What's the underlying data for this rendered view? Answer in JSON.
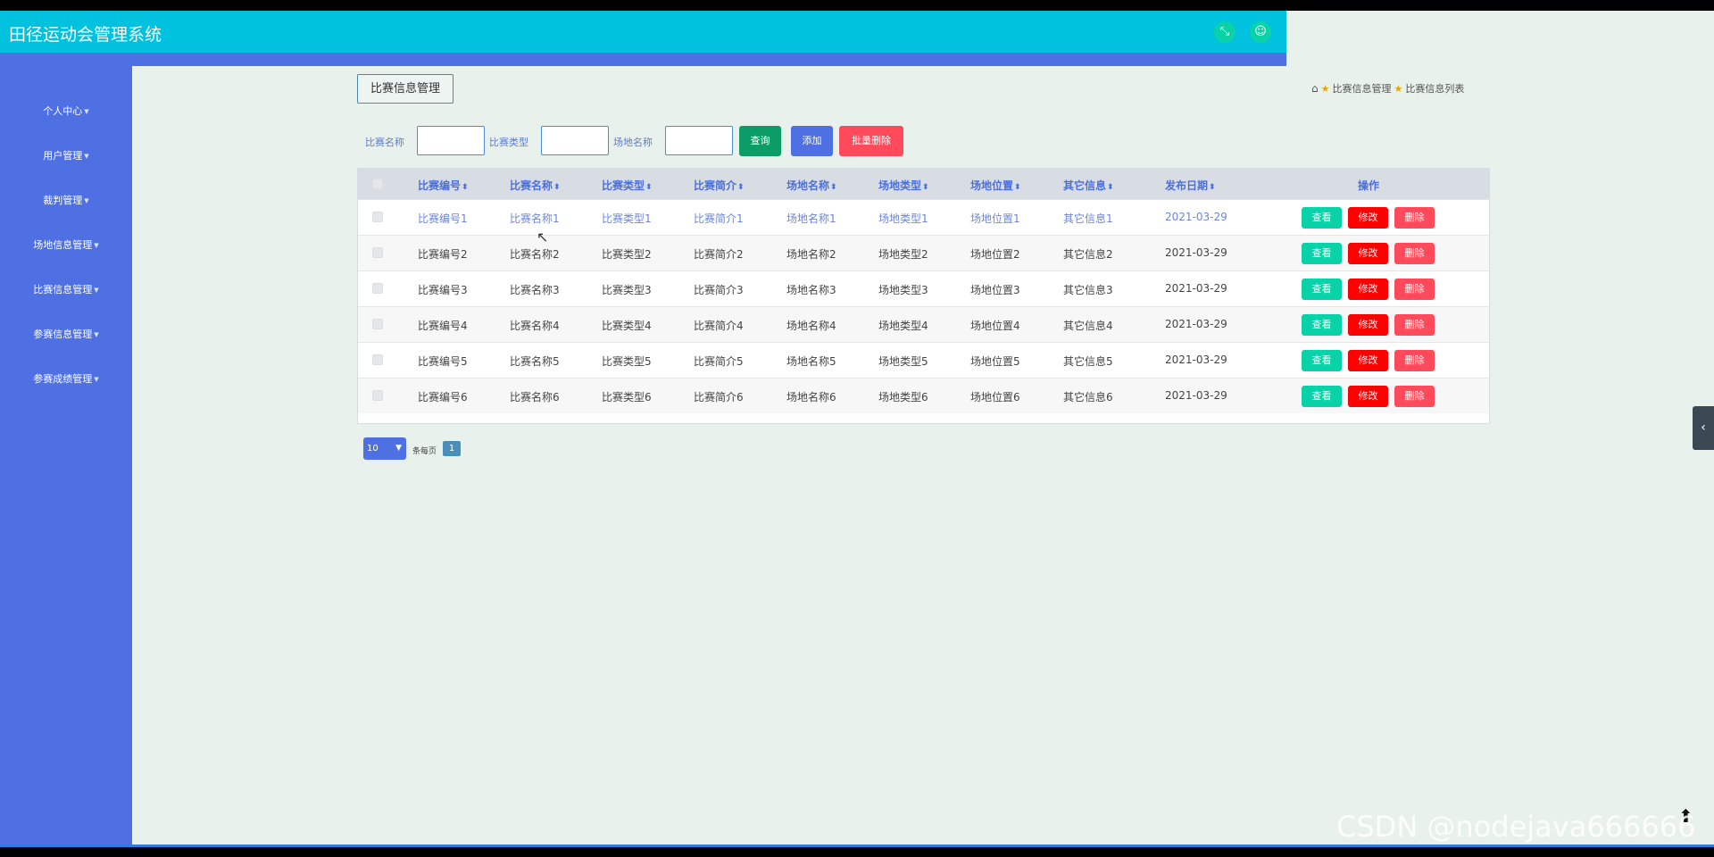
{
  "app": {
    "title": "田径运动会管理系统"
  },
  "header": {
    "fullscreen_icon": "expand-icon",
    "user_icon": "user-icon"
  },
  "sidebar": {
    "items": [
      {
        "label": "个人中心"
      },
      {
        "label": "用户管理"
      },
      {
        "label": "裁判管理"
      },
      {
        "label": "场地信息管理"
      },
      {
        "label": "比赛信息管理"
      },
      {
        "label": "参赛信息管理"
      },
      {
        "label": "参赛成绩管理"
      }
    ]
  },
  "module_button": "比赛信息管理",
  "breadcrumb": {
    "items": [
      "比赛信息管理",
      "比赛信息列表"
    ]
  },
  "filters": {
    "labels": [
      "比赛名称",
      "比赛类型",
      "场地名称"
    ],
    "values": [
      "",
      "",
      ""
    ]
  },
  "actions": {
    "search": "查询",
    "add": "添加",
    "batch_delete": "批量删除"
  },
  "table": {
    "columns": [
      "比赛编号",
      "比赛名称",
      "比赛类型",
      "比赛简介",
      "场地名称",
      "场地类型",
      "场地位置",
      "其它信息",
      "发布日期",
      "操作"
    ],
    "sort_icon": "⬍",
    "rows": [
      [
        "比赛编号1",
        "比赛名称1",
        "比赛类型1",
        "比赛简介1",
        "场地名称1",
        "场地类型1",
        "场地位置1",
        "其它信息1",
        "2021-03-29"
      ],
      [
        "比赛编号2",
        "比赛名称2",
        "比赛类型2",
        "比赛简介2",
        "场地名称2",
        "场地类型2",
        "场地位置2",
        "其它信息2",
        "2021-03-29"
      ],
      [
        "比赛编号3",
        "比赛名称3",
        "比赛类型3",
        "比赛简介3",
        "场地名称3",
        "场地类型3",
        "场地位置3",
        "其它信息3",
        "2021-03-29"
      ],
      [
        "比赛编号4",
        "比赛名称4",
        "比赛类型4",
        "比赛简介4",
        "场地名称4",
        "场地类型4",
        "场地位置4",
        "其它信息4",
        "2021-03-29"
      ],
      [
        "比赛编号5",
        "比赛名称5",
        "比赛类型5",
        "比赛简介5",
        "场地名称5",
        "场地类型5",
        "场地位置5",
        "其它信息5",
        "2021-03-29"
      ],
      [
        "比赛编号6",
        "比赛名称6",
        "比赛类型6",
        "比赛简介6",
        "场地名称6",
        "场地类型6",
        "场地位置6",
        "其它信息6",
        "2021-03-29"
      ]
    ],
    "row_actions": {
      "view": "查看",
      "edit": "修改",
      "delete": "删除"
    }
  },
  "pagination": {
    "page_size": "10",
    "per_page_label": "条每页",
    "current_page": "1"
  },
  "watermark": "CSDN @nodejava666666",
  "colors": {
    "header": "#00c1de",
    "sidebar": "#4e70e3",
    "background": "#e9f1ec",
    "search_button": "#0c9d67",
    "add_button": "#4e70e3",
    "batch_delete_button": "#ff4a5b",
    "view_button": "#0ad2a8",
    "edit_button": "#ff0000",
    "delete_button": "#ff4a5b"
  }
}
